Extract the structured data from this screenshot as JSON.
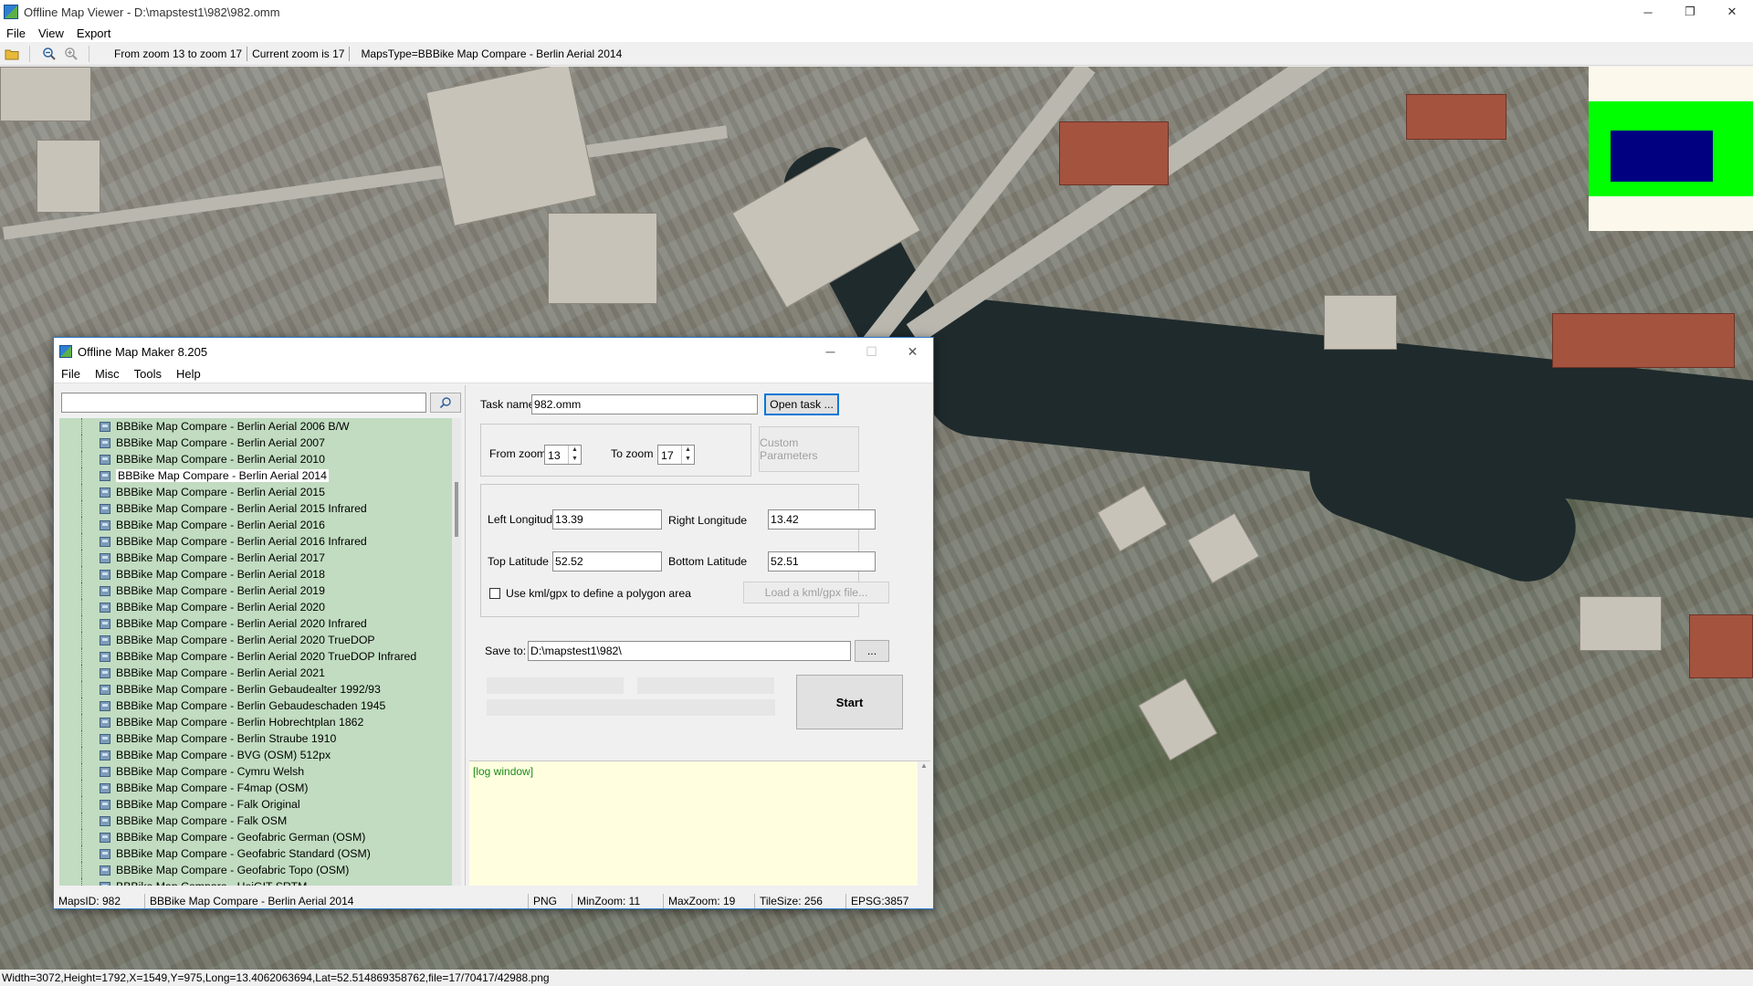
{
  "window": {
    "title": "Offline Map Viewer - D:\\mapstest1\\982\\982.omm",
    "controls": [
      "─",
      "❐",
      "✕"
    ]
  },
  "menubar": [
    "File",
    "View",
    "Export"
  ],
  "toolbar": {
    "zoom_range": "From zoom 13 to zoom 17",
    "current_zoom": "Current zoom is 17",
    "maps_type": "MapsType=BBBike Map Compare - Berlin Aerial 2014"
  },
  "statusbar": {
    "text": "Width=3072,Height=1792,X=1549,Y=975,Long=13.4062063694,Lat=52.514869358762,file=17/70417/42988.png"
  },
  "minimap": {
    "background": "#fdf8ec",
    "frame_color": "#00ff00",
    "view_color": "#000080"
  },
  "dialog": {
    "title": "Offline Map Maker 8.205",
    "controls": [
      "─",
      "☐",
      "✕"
    ],
    "menu": [
      "File",
      "Misc",
      "Tools",
      "Help"
    ],
    "search": {
      "value": ""
    },
    "tree_items": [
      "BBBike Map Compare - Berlin Aerial 2006 B/W",
      "BBBike Map Compare - Berlin Aerial 2007",
      "BBBike Map Compare - Berlin Aerial 2010",
      "BBBike Map Compare - Berlin Aerial 2014",
      "BBBike Map Compare - Berlin Aerial 2015",
      "BBBike Map Compare - Berlin Aerial 2015 Infrared",
      "BBBike Map Compare - Berlin Aerial 2016",
      "BBBike Map Compare - Berlin Aerial 2016 Infrared",
      "BBBike Map Compare - Berlin Aerial 2017",
      "BBBike Map Compare - Berlin Aerial 2018",
      "BBBike Map Compare - Berlin Aerial 2019",
      "BBBike Map Compare - Berlin Aerial 2020",
      "BBBike Map Compare - Berlin Aerial 2020 Infrared",
      "BBBike Map Compare - Berlin Aerial 2020 TrueDOP",
      "BBBike Map Compare - Berlin Aerial 2020 TrueDOP Infrared",
      "BBBike Map Compare - Berlin Aerial 2021",
      "BBBike Map Compare - Berlin Gebaudealter 1992/93",
      "BBBike Map Compare - Berlin Gebaudeschaden 1945",
      "BBBike Map Compare - Berlin Hobrechtplan 1862",
      "BBBike Map Compare - Berlin Straube 1910",
      "BBBike Map Compare - BVG (OSM) 512px",
      "BBBike Map Compare - Cymru Welsh",
      "BBBike Map Compare - F4map (OSM)",
      "BBBike Map Compare - Falk Original",
      "BBBike Map Compare - Falk OSM",
      "BBBike Map Compare - Geofabric German (OSM)",
      "BBBike Map Compare - Geofabric Standard (OSM)",
      "BBBike Map Compare - Geofabric Topo (OSM)",
      "BBBike Map Compare - HeiGIT SRTM"
    ],
    "selected_index": 3,
    "task_name_label": "Task name",
    "task_name_value": "982.omm",
    "open_task_button": "Open task ...",
    "from_zoom_label": "From zoom",
    "from_zoom_value": "13",
    "to_zoom_label": "To zoom",
    "to_zoom_value": "17",
    "custom_params_button": "Custom Parameters",
    "left_longitude_label": "Left Longitude",
    "left_longitude_value": "13.39",
    "right_longitude_label": "Right Longitude",
    "right_longitude_value": "13.42",
    "top_latitude_label": "Top Latitude",
    "top_latitude_value": "52.52",
    "bottom_latitude_label": "Bottom Latitude",
    "bottom_latitude_value": "52.51",
    "kml_checkbox_label": "Use kml/gpx to define a polygon area",
    "kml_checked": false,
    "load_kml_button": "Load a kml/gpx file...",
    "save_to_label": "Save to:",
    "save_to_value": "D:\\mapstest1\\982\\",
    "browse_button": "...",
    "start_button": "Start",
    "log_text": "[log window]",
    "status": {
      "maps_id": "MapsID: 982",
      "map_name": "BBBike Map Compare - Berlin Aerial 2014",
      "format": "PNG",
      "min_zoom": "MinZoom: 11",
      "max_zoom": "MaxZoom: 19",
      "tile_size": "TileSize: 256",
      "epsg": "EPSG:3857"
    }
  }
}
